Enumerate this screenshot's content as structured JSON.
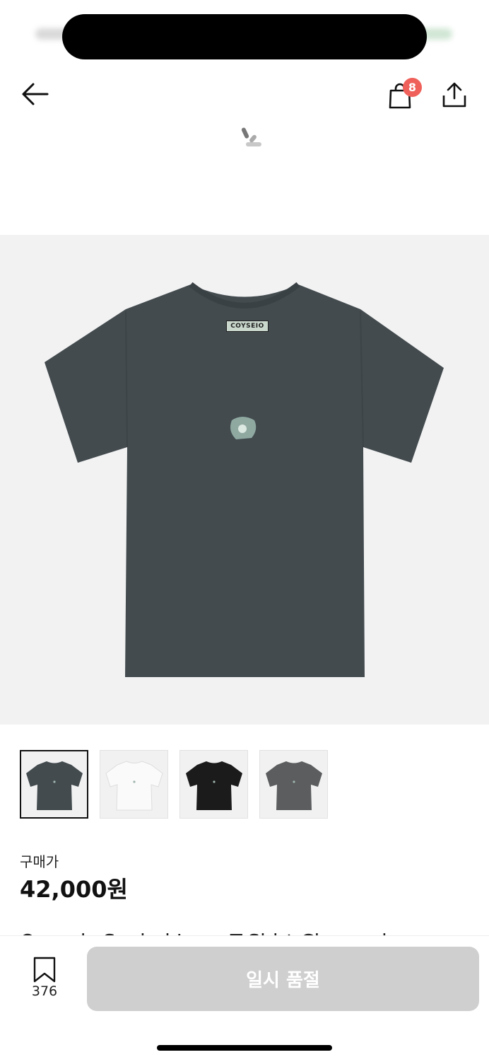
{
  "header": {
    "cart_badge": "8"
  },
  "product": {
    "brand_tag": "COYSEIO",
    "thumbnails": [
      {
        "color_name": "charcoal",
        "shirt_color": "#434b4f",
        "selected": true
      },
      {
        "color_name": "white",
        "shirt_color": "#fafafa",
        "selected": false
      },
      {
        "color_name": "black",
        "shirt_color": "#1b1b1b",
        "selected": false
      },
      {
        "color_name": "grey",
        "shirt_color": "#5b5d5e",
        "selected": false
      }
    ],
    "price_label": "구매가",
    "price": "42,000원",
    "title_peek": "Organic Sealed Logo T-Shirt Charcoal"
  },
  "bottom_bar": {
    "save_count": "376",
    "soldout_label": "일시 품절"
  },
  "colors": {
    "badge": "#f0605a",
    "hero_bg": "#f2f2f2",
    "shirt": "#434b4f",
    "button_disabled": "#cfcfcf"
  }
}
